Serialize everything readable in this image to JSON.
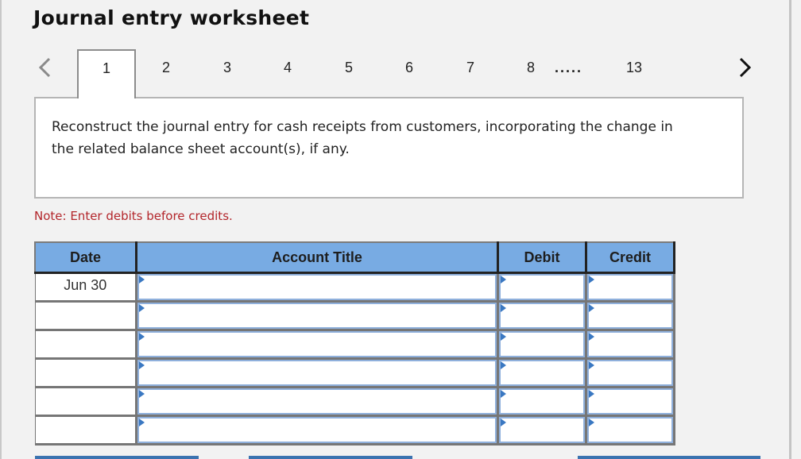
{
  "header": {
    "title": "Journal entry worksheet"
  },
  "pagination": {
    "prev_icon": "chevron-left-icon",
    "next_icon": "chevron-right-icon",
    "tabs": [
      "1",
      "2",
      "3",
      "4",
      "5",
      "6",
      "7",
      "8"
    ],
    "active_tab": "1",
    "ellipsis": ".....",
    "last_tab": "13"
  },
  "question": {
    "text": "Reconstruct the journal entry for cash receipts from customers, incorporating the change in the related balance sheet account(s), if any."
  },
  "note": {
    "text": "Note: Enter debits before credits.",
    "color": "#b3262b"
  },
  "table": {
    "header_color": "#78abe3",
    "columns": [
      "Date",
      "Account Title",
      "Debit",
      "Credit"
    ],
    "rows": [
      {
        "date": "Jun 30",
        "account": "",
        "debit": "",
        "credit": ""
      },
      {
        "date": "",
        "account": "",
        "debit": "",
        "credit": ""
      },
      {
        "date": "",
        "account": "",
        "debit": "",
        "credit": ""
      },
      {
        "date": "",
        "account": "",
        "debit": "",
        "credit": ""
      },
      {
        "date": "",
        "account": "",
        "debit": "",
        "credit": ""
      },
      {
        "date": "",
        "account": "",
        "debit": "",
        "credit": ""
      }
    ]
  }
}
